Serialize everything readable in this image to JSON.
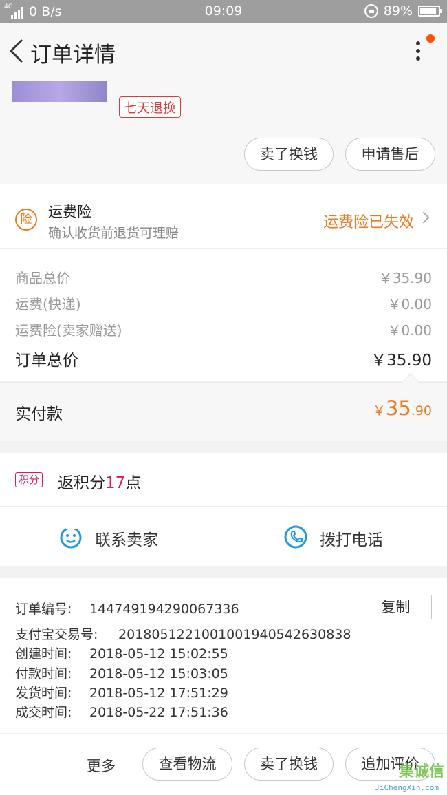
{
  "status_bar": {
    "network": "4G",
    "speed": "0 B/s",
    "time": "09:09",
    "battery": "89%",
    "battery_level": 0.89
  },
  "header": {
    "title": "订单详情"
  },
  "product": {
    "tag": "七天退换",
    "actions": [
      "卖了换钱",
      "申请售后"
    ]
  },
  "insurance": {
    "icon_text": "险",
    "title": "运费险",
    "subtitle": "确认收货前退货可理赔",
    "status": "运费险已失效"
  },
  "price": {
    "rows": [
      {
        "label": "商品总价",
        "value": "￥35.90"
      },
      {
        "label": "运费(快递)",
        "value": "￥0.00"
      },
      {
        "label": "运费险(卖家赠送)",
        "value": "￥0.00"
      }
    ],
    "total_label": "订单总价",
    "total_value": "￥35.90"
  },
  "payment": {
    "label": "实付款",
    "currency": "￥",
    "integer": "35",
    "decimal": ".90"
  },
  "points": {
    "badge": "积分",
    "prefix": "返积分",
    "number": "17",
    "suffix": "点"
  },
  "contact": {
    "seller": "联系卖家",
    "phone": "拨打电话"
  },
  "order_info": {
    "number_label": "订单编号:",
    "number": "144749194290067336",
    "copy": "复制",
    "rows": [
      {
        "label": "支付宝交易号:",
        "value": "2018051221001001940542630838"
      },
      {
        "label": "创建时间:",
        "value": "2018-05-12 15:02:55"
      },
      {
        "label": "付款时间:",
        "value": "2018-05-12 15:03:05"
      },
      {
        "label": "发货时间:",
        "value": "2018-05-12 17:51:29"
      },
      {
        "label": "成交时间:",
        "value": "2018-05-22 17:51:36"
      }
    ]
  },
  "bottom_bar": {
    "more": "更多",
    "buttons": [
      "查看物流",
      "卖了换钱",
      "追加评价"
    ]
  },
  "watermark": {
    "logo": "集诚信",
    "url": "JiChengXin.com"
  },
  "colors": {
    "accent": "#f0781e",
    "red": "#e4393c",
    "points": "#d81b60",
    "contact_icon": "#1e9be6"
  }
}
